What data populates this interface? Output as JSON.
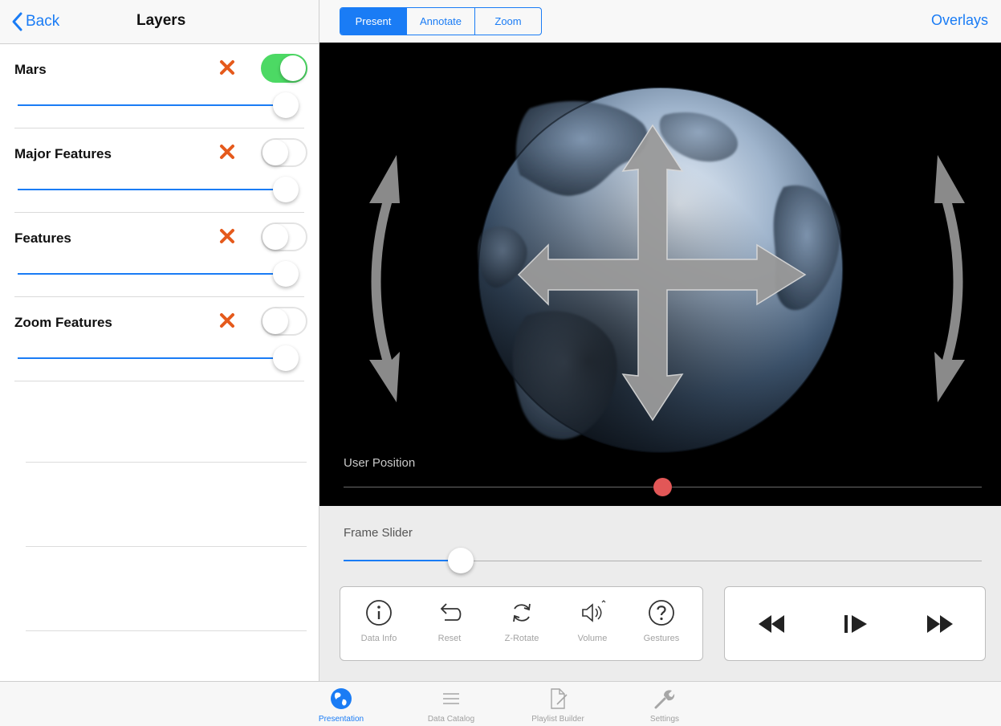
{
  "left_panel": {
    "back_label": "Back",
    "title": "Layers",
    "layers": [
      {
        "name": "Mars",
        "enabled": true,
        "opacity": 1.0
      },
      {
        "name": "Major Features",
        "enabled": false,
        "opacity": 1.0
      },
      {
        "name": "Features",
        "enabled": false,
        "opacity": 1.0
      },
      {
        "name": "Zoom Features",
        "enabled": false,
        "opacity": 1.0
      }
    ]
  },
  "top_bar": {
    "modes": [
      "Present",
      "Annotate",
      "Zoom"
    ],
    "active_mode": "Present",
    "overlays_label": "Overlays"
  },
  "viewer": {
    "user_position_label": "User Position",
    "user_position_value": 0.5
  },
  "controls": {
    "frame_slider_label": "Frame Slider",
    "frame_slider_value": 0.17,
    "tools": [
      {
        "label": "Data Info",
        "icon": "info-icon"
      },
      {
        "label": "Reset",
        "icon": "undo-icon"
      },
      {
        "label": "Z-Rotate",
        "icon": "rotate-icon"
      },
      {
        "label": "Volume",
        "icon": "speaker-icon"
      },
      {
        "label": "Gestures",
        "icon": "question-icon"
      }
    ],
    "playback": [
      "rewind-icon",
      "play-step-icon",
      "fast-forward-icon"
    ]
  },
  "tab_bar": {
    "tabs": [
      {
        "label": "Presentation",
        "icon": "globe-icon",
        "active": true
      },
      {
        "label": "Data Catalog",
        "icon": "list-icon",
        "active": false
      },
      {
        "label": "Playlist Builder",
        "icon": "document-edit-icon",
        "active": false
      },
      {
        "label": "Settings",
        "icon": "wrench-icon",
        "active": false
      }
    ]
  },
  "colors": {
    "accent": "#1a7cf5",
    "toggle_on": "#4cd964",
    "remove": "#e55a1c",
    "user_position_thumb": "#e25757"
  }
}
